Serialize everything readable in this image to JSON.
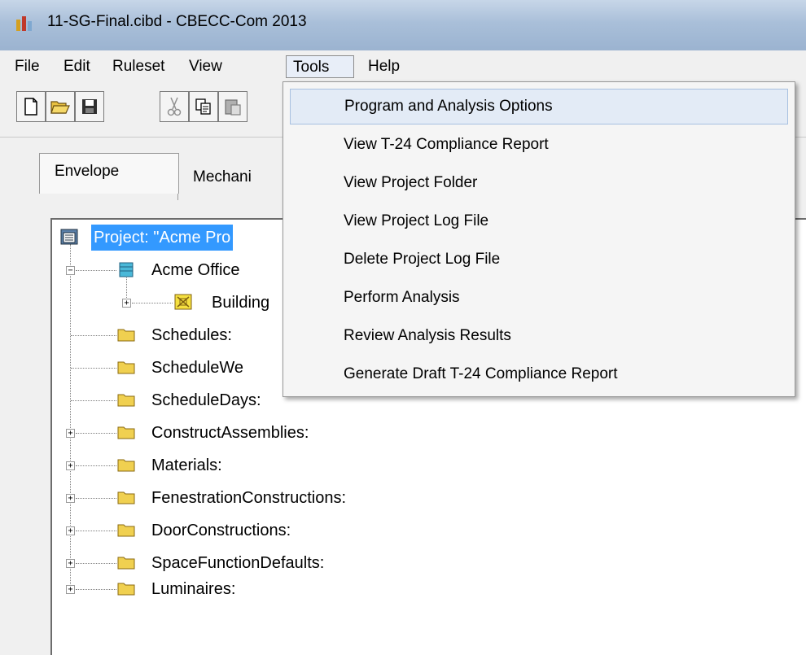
{
  "window": {
    "title": "11-SG-Final.cibd - CBECC-Com 2013",
    "icon": "app-icon"
  },
  "menubar": {
    "items": [
      {
        "label": "File"
      },
      {
        "label": "Edit"
      },
      {
        "label": "Ruleset"
      },
      {
        "label": "View"
      },
      {
        "label": "Tools",
        "active": true
      },
      {
        "label": "Help"
      }
    ]
  },
  "toolbar": {
    "buttons": [
      "new-document-icon",
      "open-folder-icon",
      "save-icon",
      "cut-icon",
      "copy-icon",
      "paste-icon"
    ]
  },
  "tabs": [
    {
      "label": "Envelope",
      "selected": true
    },
    {
      "label": "Mechani"
    }
  ],
  "tree": {
    "project": "Project:  \"Acme Pro",
    "building": "Acme Office",
    "building_child": "Building",
    "folders": [
      {
        "label": "Schedules:",
        "expandable": false
      },
      {
        "label": "ScheduleWe",
        "expandable": false
      },
      {
        "label": "ScheduleDays:",
        "expandable": false
      },
      {
        "label": "ConstructAssemblies:",
        "expandable": true
      },
      {
        "label": "Materials:",
        "expandable": true
      },
      {
        "label": "FenestrationConstructions:",
        "expandable": true
      },
      {
        "label": "DoorConstructions:",
        "expandable": true
      },
      {
        "label": "SpaceFunctionDefaults:",
        "expandable": true
      },
      {
        "label": "Luminaires:",
        "expandable": true
      }
    ]
  },
  "tools_menu": {
    "items": [
      {
        "label": "Program and Analysis Options",
        "highlighted": true
      },
      {
        "label": "View T-24 Compliance Report"
      },
      {
        "label": "View Project Folder"
      },
      {
        "label": "View Project Log File"
      },
      {
        "label": "Delete Project Log File"
      },
      {
        "label": "Perform Analysis"
      },
      {
        "label": "Review Analysis Results"
      },
      {
        "label": "Generate Draft T-24 Compliance Report"
      }
    ]
  },
  "colors": {
    "selection": "#3399ff",
    "menu_hover": "#e3ebf6",
    "folder": "#f0d050"
  }
}
